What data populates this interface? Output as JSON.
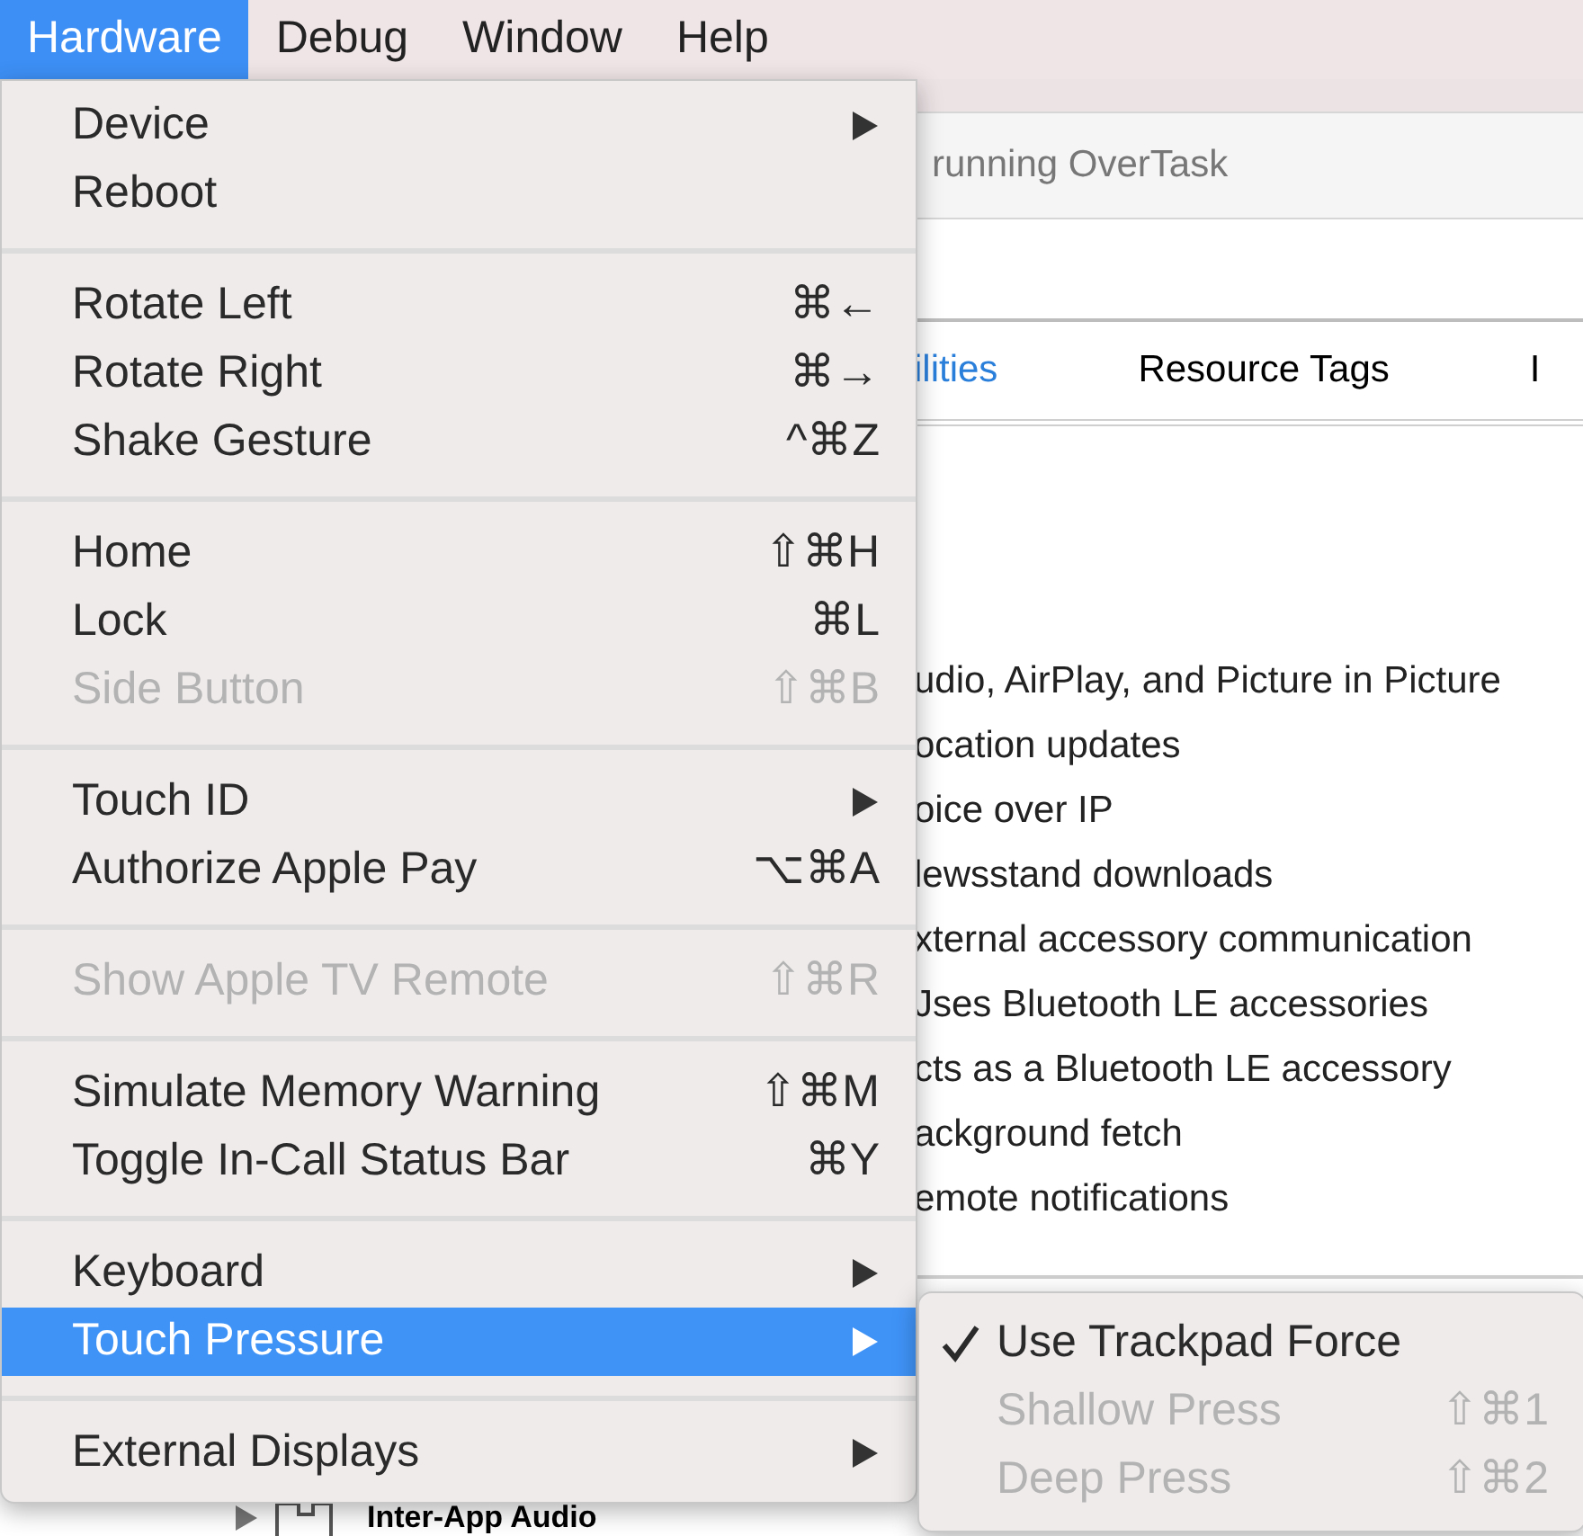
{
  "menu_bar": [
    {
      "label": "Hardware",
      "selected": true
    },
    {
      "label": "Debug",
      "selected": false
    },
    {
      "label": "Window",
      "selected": false
    },
    {
      "label": "Help",
      "selected": false
    }
  ],
  "background": {
    "status": "running OverTask",
    "tabs": [
      {
        "label": "ilities",
        "selected": true
      },
      {
        "label": "Resource Tags",
        "selected": false
      },
      {
        "label": "I",
        "selected": false
      }
    ],
    "modes": [
      "udio, AirPlay, and Picture in Picture",
      "ocation updates",
      "oice over IP",
      "lewsstand downloads",
      "xternal accessory communication",
      "Jses Bluetooth LE accessories",
      "cts as a Bluetooth LE accessory",
      "ackground fetch",
      "emote notifications"
    ],
    "tree_row": {
      "label": "Inter-App Audio",
      "expanded": false
    }
  },
  "menu": {
    "groups": [
      [
        {
          "label": "Device",
          "submenu": true,
          "disabled": false,
          "selected": false
        },
        {
          "label": "Reboot",
          "submenu": false,
          "disabled": false,
          "selected": false
        }
      ],
      [
        {
          "label": "Rotate Left",
          "shortcut": "⌘←",
          "submenu": false,
          "disabled": false,
          "selected": false
        },
        {
          "label": "Rotate Right",
          "shortcut": "⌘→",
          "submenu": false,
          "disabled": false,
          "selected": false
        },
        {
          "label": "Shake Gesture",
          "shortcut": "^⌘Z",
          "submenu": false,
          "disabled": false,
          "selected": false
        }
      ],
      [
        {
          "label": "Home",
          "shortcut": "⇧⌘H",
          "submenu": false,
          "disabled": false,
          "selected": false
        },
        {
          "label": "Lock",
          "shortcut": "⌘L",
          "submenu": false,
          "disabled": false,
          "selected": false
        },
        {
          "label": "Side Button",
          "shortcut": "⇧⌘B",
          "submenu": false,
          "disabled": true,
          "selected": false
        }
      ],
      [
        {
          "label": "Touch ID",
          "submenu": true,
          "disabled": false,
          "selected": false
        },
        {
          "label": "Authorize Apple Pay",
          "shortcut": "⌥⌘A",
          "submenu": false,
          "disabled": false,
          "selected": false
        }
      ],
      [
        {
          "label": "Show Apple TV Remote",
          "shortcut": "⇧⌘R",
          "submenu": false,
          "disabled": true,
          "selected": false
        }
      ],
      [
        {
          "label": "Simulate Memory Warning",
          "shortcut": "⇧⌘M",
          "submenu": false,
          "disabled": false,
          "selected": false
        },
        {
          "label": "Toggle In-Call Status Bar",
          "shortcut": "⌘Y",
          "submenu": false,
          "disabled": false,
          "selected": false
        }
      ],
      [
        {
          "label": "Keyboard",
          "submenu": true,
          "disabled": false,
          "selected": false
        },
        {
          "label": "Touch Pressure",
          "submenu": true,
          "disabled": false,
          "selected": true
        }
      ],
      [
        {
          "label": "External Displays",
          "submenu": true,
          "disabled": false,
          "selected": false
        }
      ]
    ]
  },
  "submenu": [
    {
      "label": "Use Trackpad Force",
      "checked": true,
      "disabled": false
    },
    {
      "label": "Shallow Press",
      "shortcut": "⇧⌘1",
      "checked": false,
      "disabled": true
    },
    {
      "label": "Deep Press",
      "shortcut": "⇧⌘2",
      "checked": false,
      "disabled": true
    }
  ]
}
